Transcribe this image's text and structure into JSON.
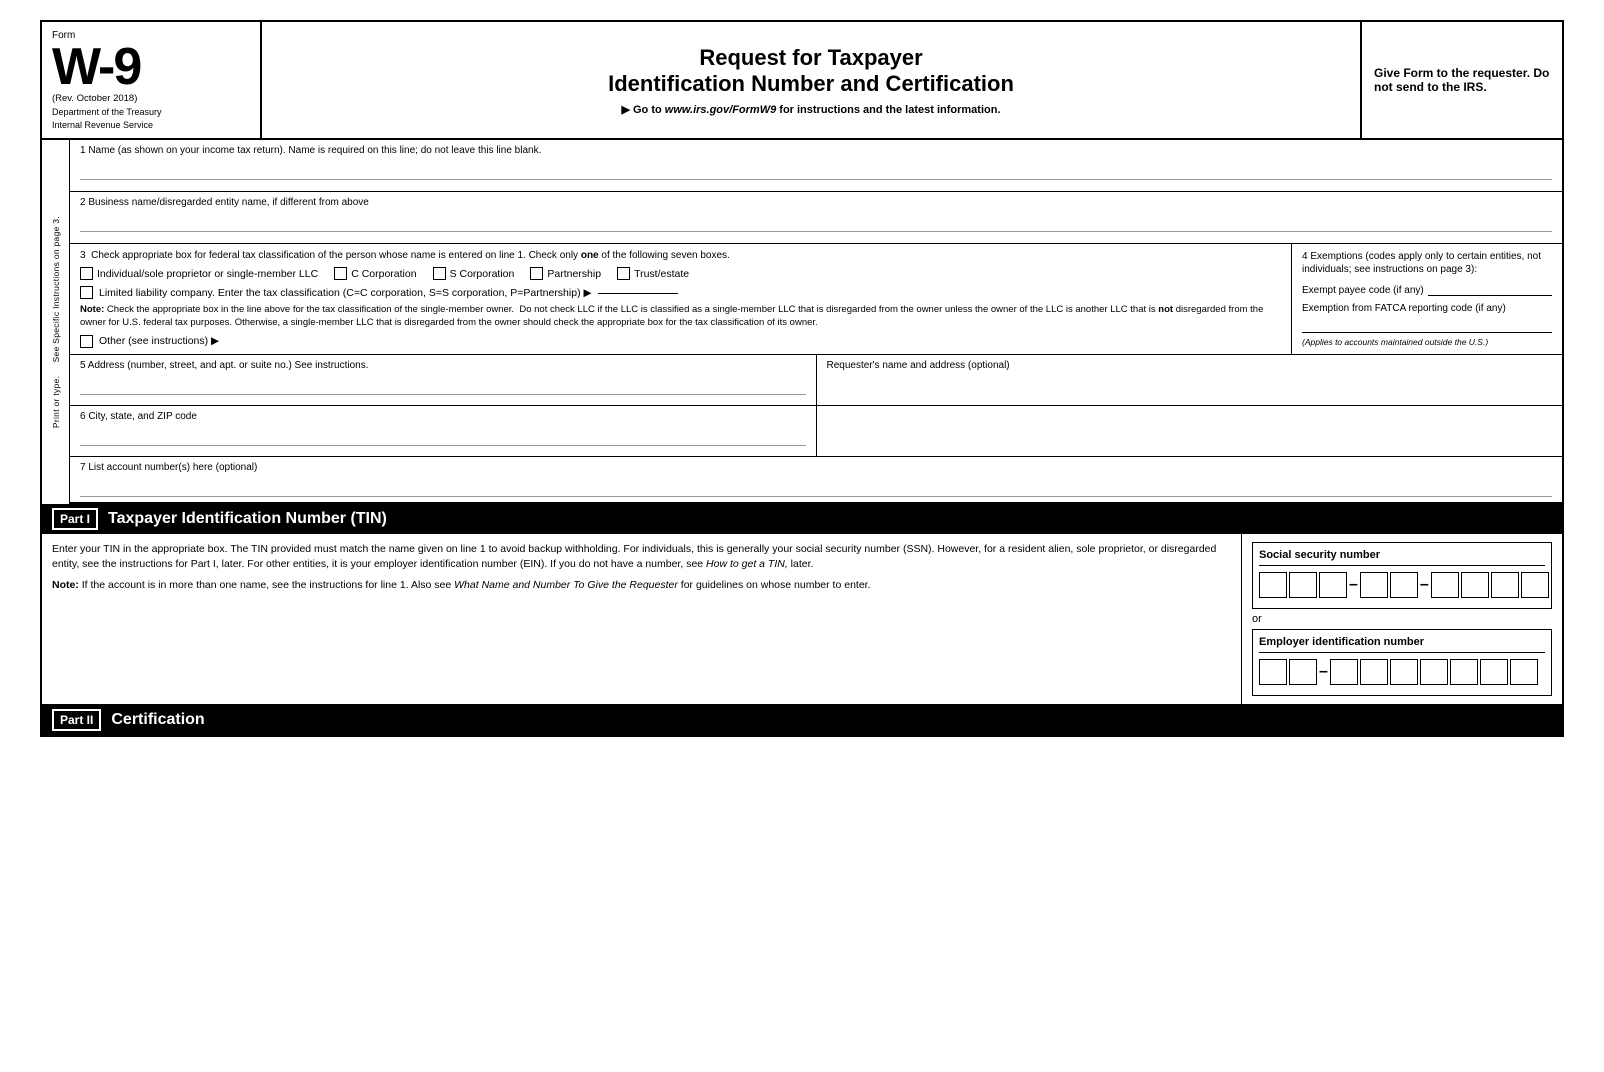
{
  "header": {
    "form_label": "Form",
    "form_number": "W-9",
    "rev": "(Rev. October 2018)",
    "dept1": "Department of the Treasury",
    "dept2": "Internal Revenue Service",
    "title_main": "Request for Taxpayer",
    "title_sub": "Identification Number and Certification",
    "goto": "▶ Go to www.irs.gov/FormW9 for instructions and the latest information.",
    "give_form": "Give Form to the requester. Do not send to the IRS."
  },
  "sidebar": {
    "text": "Print or type.   See Specific Instructions on page 3."
  },
  "fields": {
    "field1_label": "1  Name (as shown on your income tax return). Name is required on this line; do not leave this line blank.",
    "field2_label": "2  Business name/disregarded entity name, if different from above",
    "field3_label": "3  Check appropriate box for federal tax classification of the person whose name is entered on line 1. Check only",
    "field3_label_bold": "one",
    "field3_label2": "of the following seven boxes.",
    "cb_individual": "Individual/sole proprietor or single-member LLC",
    "cb_c_corp": "C Corporation",
    "cb_s_corp": "S Corporation",
    "cb_partnership": "Partnership",
    "cb_trust": "Trust/estate",
    "llc_label": "Limited liability company. Enter the tax classification (C=C corporation, S=S corporation, P=Partnership) ▶",
    "note_bold": "Note:",
    "note_text": "Check the appropriate box in the line above for the tax classification of the single-member owner.  Do not check LLC if the LLC is classified as a single-member LLC that is disregarded from the owner unless the owner of the LLC is another LLC that is",
    "note_bold2": "not",
    "note_text2": "disregarded from the owner for U.S. federal tax purposes. Otherwise, a single-member LLC that is disregarded from the owner should check the appropriate box for the tax classification of its owner.",
    "other_label": "Other (see instructions) ▶",
    "field4_label": "4  Exemptions (codes apply only to certain entities, not individuals; see instructions on page 3):",
    "exempt_payee": "Exempt payee code (if any)",
    "fatca_label": "Exemption from FATCA reporting code (if any)",
    "fatca_note": "(Applies to accounts maintained outside the U.S.)",
    "field5_label": "5  Address (number, street, and apt. or suite no.) See instructions.",
    "field5_right": "Requester's name and address (optional)",
    "field6_label": "6  City, state, and ZIP code",
    "field7_label": "7  List account number(s) here (optional)"
  },
  "part1": {
    "badge": "Part I",
    "title": "Taxpayer Identification Number (TIN)",
    "body": "Enter your TIN in the appropriate box. The TIN provided must match the name given on line 1 to avoid backup withholding. For individuals, this is generally your social security number (SSN). However, for a resident alien, sole proprietor, or disregarded entity, see the instructions for Part I, later. For other entities, it is your employer identification number (EIN). If you do not have a number, see",
    "body_italic": "How to get a TIN,",
    "body2": "later.",
    "note_bold": "Note:",
    "note_text": "If the account is in more than one name, see the instructions for line 1. Also see",
    "note_italic": "What Name and Number To Give the Requester",
    "note_text2": "for guidelines on whose number to enter.",
    "ssn_label": "Social security number",
    "or_text": "or",
    "ein_label": "Employer identification number"
  },
  "part2": {
    "badge": "Part II",
    "title": "Certification"
  }
}
